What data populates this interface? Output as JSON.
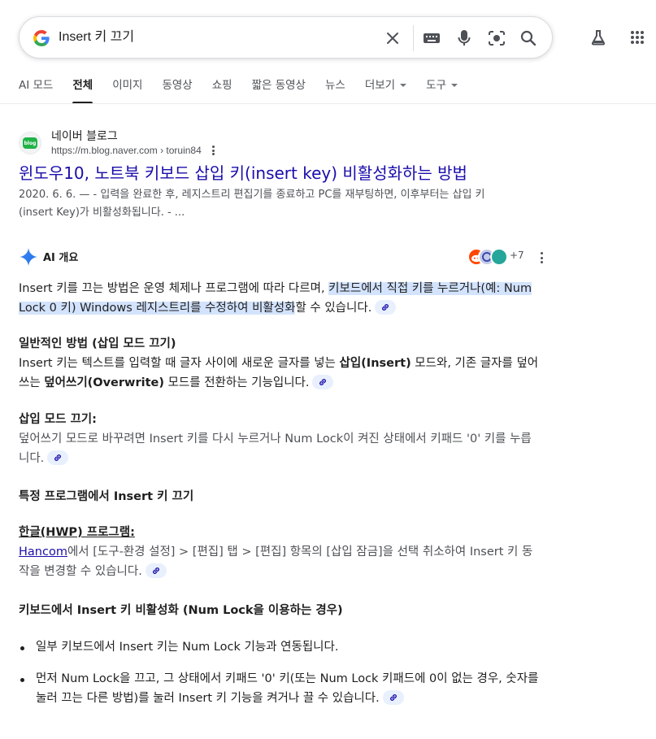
{
  "search": {
    "query": "Insert 키 끄기"
  },
  "tabs": [
    {
      "label": "AI 모드"
    },
    {
      "label": "전체"
    },
    {
      "label": "이미지"
    },
    {
      "label": "동영상"
    },
    {
      "label": "쇼핑"
    },
    {
      "label": "짧은 동영상"
    },
    {
      "label": "뉴스"
    },
    {
      "label": "더보기"
    },
    {
      "label": "도구"
    }
  ],
  "result": {
    "site_name": "네이버 블로그",
    "url": "https://m.blog.naver.com › toruin84",
    "favicon_text": "blog",
    "title": "윈도우10, 노트북 키보드 삽입 키(insert key) 비활성화하는 방법",
    "snippet_line1": "2020. 6. 6. — - 입력을 완료한 후, 레지스트리 편집기를 종료하고 PC를 재부팅하면, 이후부터는 삽입 키",
    "snippet_line2": "(insert Key)가 비활성화됩니다. - ..."
  },
  "ai_overview": {
    "title": "AI 개요",
    "plus_count": "+7",
    "intro_plain": "Insert 키를 끄는 방법은 운영 체제나 프로그램에 따라 다르며, ",
    "intro_highlight": "키보드에서 직접 키를 누르거나(예: Num Lock 0 키) Windows 레지스트리를 수정하여 비활성화",
    "intro_end": "할 수 있습니다.",
    "s1_heading": "일반적인 방법 (삽입 모드 끄기)",
    "s1_p1": "Insert 키는 텍스트를 입력할 때 글자 사이에 새로운 글자를 넣는 ",
    "s1_b1": "삽입(Insert)",
    "s1_p2": " 모드와, 기존 글자를 덮어쓰는 ",
    "s1_b2": "덮어쓰기(Overwrite)",
    "s1_p3": " 모드를 전환하는 기능입니다.",
    "s2_heading": "삽입 모드 끄기:",
    "s2_text": "덮어쓰기 모드로 바꾸려면 Insert 키를 다시 누르거나 Num Lock이 켜진 상태에서 키패드 '0' 키를 누릅니다.",
    "s3_heading": "특정 프로그램에서 Insert 키 끄기",
    "s4_heading": "한글(HWP) 프로그램:",
    "s4_link": "Hancom",
    "s4_text": "에서 [도구-환경 설정] > [편집] 탭 > [편집] 항목의 [삽입 잠금]을 선택 취소하여 Insert 키 동작을 변경할 수 있습니다.",
    "s5_heading": "키보드에서 Insert 키 비활성화 (Num Lock을 이용하는 경우)",
    "bullet1": "일부 키보드에서 Insert 키는 Num Lock 기능과 연동됩니다.",
    "bullet2": "먼저 Num Lock을 끄고, 그 상태에서 키패드 '0' 키(또는 Num Lock 키패드에 0이 없는 경우, 숫자를 눌러 끄는 다른 방법)를 눌러 Insert 키 기능을 켜거나 끌 수 있습니다."
  },
  "colors": {
    "link_title": "#1a0dab",
    "highlight": "#d3e3fd",
    "chip": "#e8f0fe",
    "gray_text": "#4d5156"
  }
}
